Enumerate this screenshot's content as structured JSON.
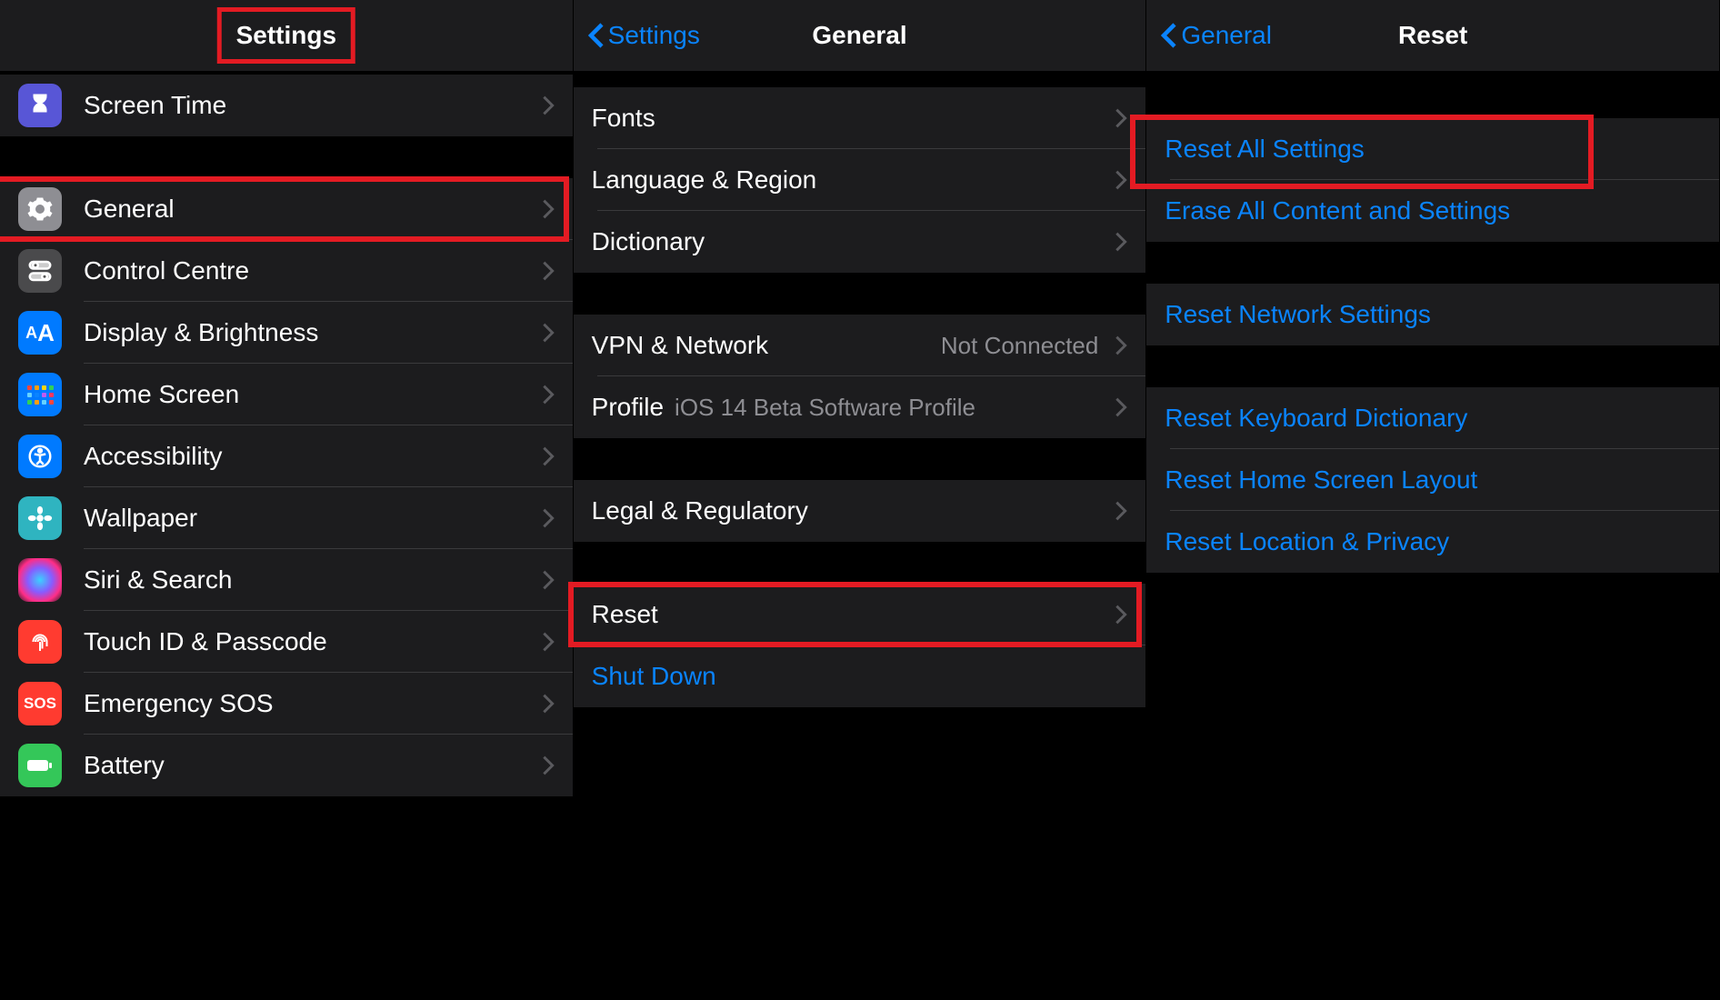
{
  "colors": {
    "accent": "#0a84ff",
    "highlight": "#e31b23",
    "textSecondary": "#8e8e93"
  },
  "panel1": {
    "title": "Settings",
    "rows": {
      "screenTime": "Screen Time",
      "general": "General",
      "controlCentre": "Control Centre",
      "displayBrightness": "Display & Brightness",
      "homeScreen": "Home Screen",
      "accessibility": "Accessibility",
      "wallpaper": "Wallpaper",
      "siriSearch": "Siri & Search",
      "touchId": "Touch ID & Passcode",
      "emergencySos": "Emergency SOS",
      "battery": "Battery"
    }
  },
  "panel2": {
    "back": "Settings",
    "title": "General",
    "rows": {
      "fonts": "Fonts",
      "languageRegion": "Language & Region",
      "dictionary": "Dictionary",
      "vpnNetwork": "VPN & Network",
      "vpnNetworkValue": "Not Connected",
      "profile": "Profile",
      "profileValue": "iOS 14 Beta Software Profile",
      "legalRegulatory": "Legal & Regulatory",
      "reset": "Reset",
      "shutDown": "Shut Down"
    }
  },
  "panel3": {
    "back": "General",
    "title": "Reset",
    "rows": {
      "resetAll": "Reset All Settings",
      "eraseAll": "Erase All Content and Settings",
      "resetNetwork": "Reset Network Settings",
      "resetKeyboard": "Reset Keyboard Dictionary",
      "resetHome": "Reset Home Screen Layout",
      "resetLocation": "Reset Location & Privacy"
    }
  }
}
